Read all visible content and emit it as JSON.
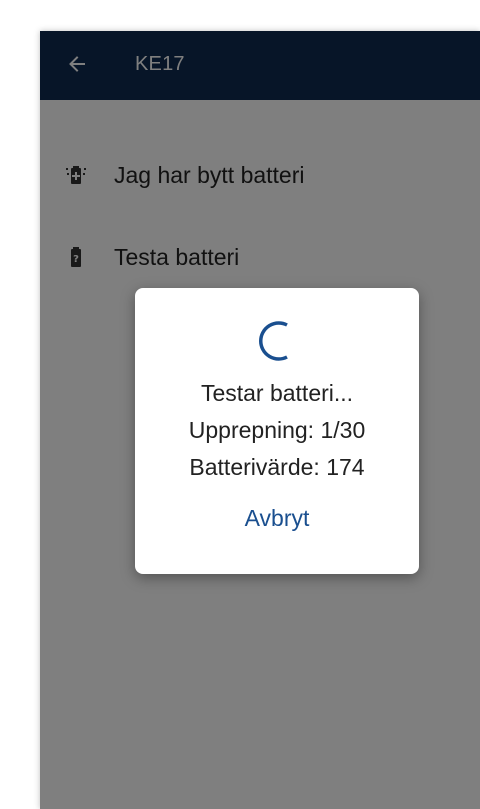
{
  "app_bar": {
    "back_icon": "arrow-left-icon",
    "title": "KE17",
    "background": "#0e2a50"
  },
  "menu": {
    "items": [
      {
        "icon": "battery-replaced-icon",
        "label": "Jag har bytt batteri"
      },
      {
        "icon": "battery-test-icon",
        "label": "Testa batteri"
      }
    ]
  },
  "dialog": {
    "spinner_icon": "progress-spinner-icon",
    "status": "Testar batteri...",
    "repetition": "Upprepning: 1/30",
    "battery_value": "Batterivärde: 174",
    "cancel_label": "Avbryt",
    "accent_color": "#1a4f8f"
  }
}
